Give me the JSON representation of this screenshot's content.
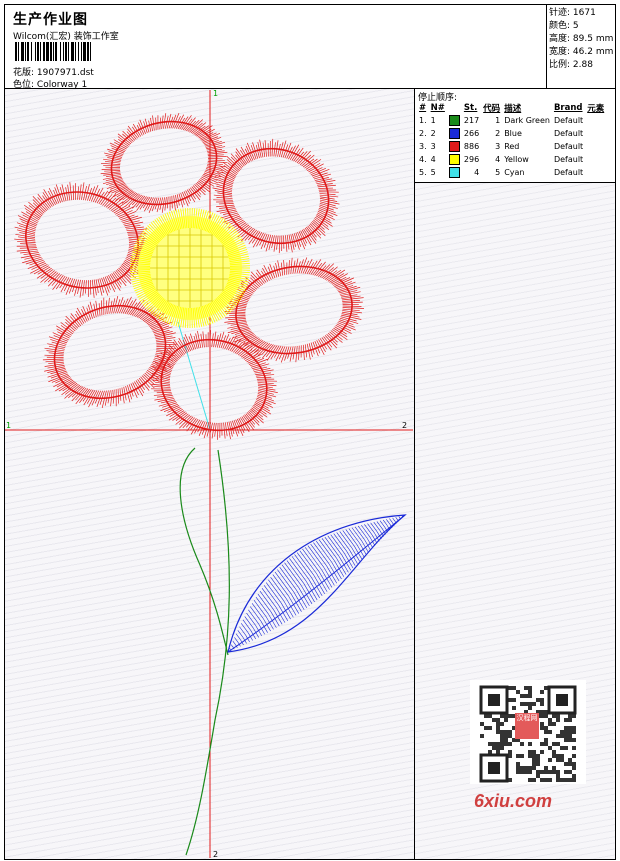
{
  "header": {
    "title": "生产作业图",
    "company": "Wilcom(汇宏) 装饰工作室",
    "design_label": "花版:",
    "design_value": "1907971.dst",
    "colorway_label": "色位:",
    "colorway_value": "Colorway 1"
  },
  "stats": [
    {
      "label": "针迹:",
      "value": "1671"
    },
    {
      "label": "颜色:",
      "value": "5"
    },
    {
      "label": "高度:",
      "value": "89.5 mm"
    },
    {
      "label": "宽度:",
      "value": "46.2 mm"
    },
    {
      "label": "比例:",
      "value": "2.88"
    }
  ],
  "stop_sequence": {
    "label": "停止顺序:",
    "columns": [
      "#",
      "N#",
      "St.",
      "代码",
      "描述",
      "Brand",
      "元素"
    ],
    "rows": [
      {
        "idx": "1.",
        "n": "1",
        "st": "217",
        "code": "1",
        "desc": "Dark Green",
        "brand": "Default",
        "color": "#1a8a1a"
      },
      {
        "idx": "2.",
        "n": "2",
        "st": "266",
        "code": "2",
        "desc": "Blue",
        "brand": "Default",
        "color": "#1a2ad8"
      },
      {
        "idx": "3.",
        "n": "3",
        "st": "886",
        "code": "3",
        "desc": "Red",
        "brand": "Default",
        "color": "#e01a1a"
      },
      {
        "idx": "4.",
        "n": "4",
        "st": "296",
        "code": "4",
        "desc": "Yellow",
        "brand": "Default",
        "color": "#ffff00"
      },
      {
        "idx": "5.",
        "n": "5",
        "st": "4",
        "code": "5",
        "desc": "Cyan",
        "brand": "Default",
        "color": "#40e0e8"
      }
    ]
  },
  "axes": {
    "top": "1",
    "left": "1",
    "right": "2",
    "bottom": "2"
  },
  "watermark": {
    "text": "6xiu.com",
    "stamp": "汉程网"
  }
}
